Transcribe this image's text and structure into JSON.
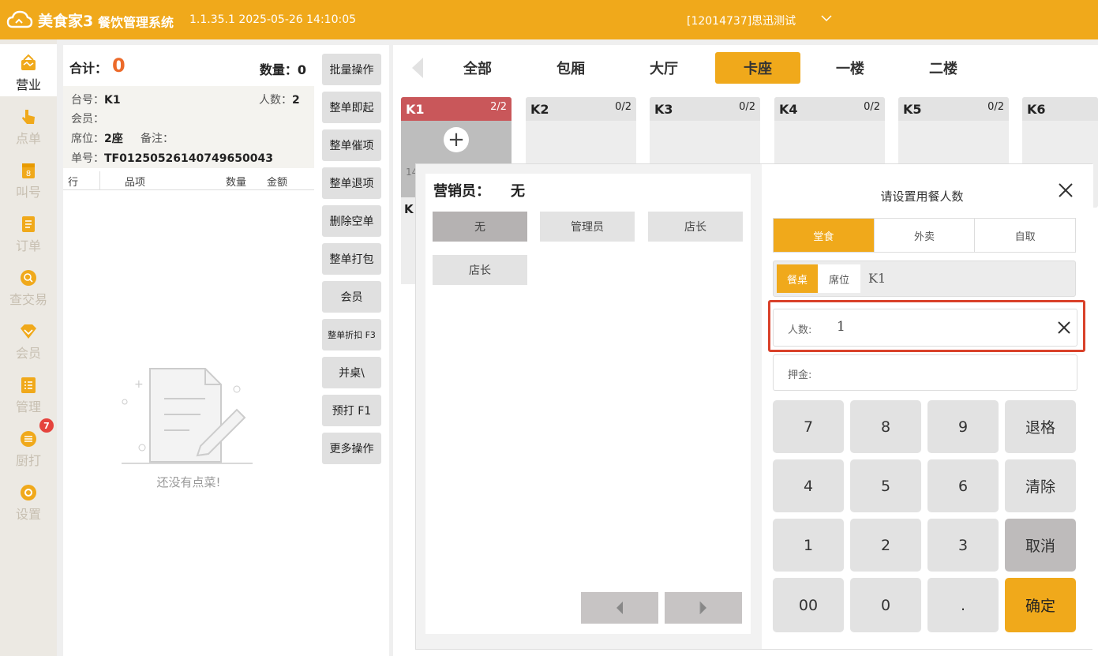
{
  "topbar": {
    "logo_text": "美食家3",
    "app_name": "餐饮管理系统",
    "version": "1.1.35.1 2025-05-26 14:10:05",
    "store": "[12014737]思迅测试"
  },
  "sidebar": {
    "items": [
      {
        "label": "营业"
      },
      {
        "label": "点单"
      },
      {
        "label": "叫号"
      },
      {
        "label": "订单"
      },
      {
        "label": "查交易"
      },
      {
        "label": "会员"
      },
      {
        "label": "管理"
      },
      {
        "label": "厨打"
      },
      {
        "label": "设置"
      }
    ],
    "badge": "7"
  },
  "order": {
    "total_label": "合计：",
    "total_value": "0",
    "qty_label": "数量：",
    "qty_value": "0",
    "table_label": "台号：",
    "table_value": "K1",
    "people_label": "人数：",
    "people_value": "2",
    "member_label": "会员：",
    "seat_label": "席位：",
    "seat_value": "2座",
    "remark_label": "备注：",
    "no_label": "单号：",
    "no_value": "TF01250526140749650043",
    "columns": [
      "行",
      "品项",
      "数量",
      "金额"
    ],
    "empty_text": "还没有点菜!"
  },
  "actions": [
    "批量操作",
    "整单即起",
    "整单催项",
    "整单退项",
    "删除空单",
    "整单打包",
    "会员",
    "整单折扣 F3",
    "并桌\\",
    "预打 F1",
    "更多操作"
  ],
  "area_tabs": [
    "全部",
    "包厢",
    "大厅",
    "卡座",
    "一楼",
    "二楼"
  ],
  "tables": [
    {
      "name": "K1",
      "count": "2/2"
    },
    {
      "name": "K2",
      "count": "0/2"
    },
    {
      "name": "K3",
      "count": "0/2"
    },
    {
      "name": "K4",
      "count": "0/2"
    },
    {
      "name": "K5",
      "count": "0/2"
    },
    {
      "name": "K6",
      "count": ""
    }
  ],
  "table_misc": {
    "k1_partial": "14",
    "row2_partial": "K"
  },
  "sales": {
    "title": "营销员：",
    "value": "无",
    "options": [
      "无",
      "管理员",
      "店长",
      "店长"
    ]
  },
  "dialog": {
    "title": "请设置用餐人数",
    "modes": [
      "堂食",
      "外卖",
      "自取"
    ],
    "seat_tab1": "餐桌",
    "seat_tab2": "席位",
    "seat_value": "K1",
    "people_label": "人数:",
    "people_value": "1",
    "deposit_label": "押金:",
    "keys": [
      "7",
      "8",
      "9",
      "退格",
      "4",
      "5",
      "6",
      "清除",
      "1",
      "2",
      "3",
      "取消",
      "00",
      "0",
      ".",
      "确定"
    ]
  },
  "colors": {
    "accent": "#f0a91b",
    "occupied": "#c9575a",
    "highlight": "#d9412a"
  }
}
